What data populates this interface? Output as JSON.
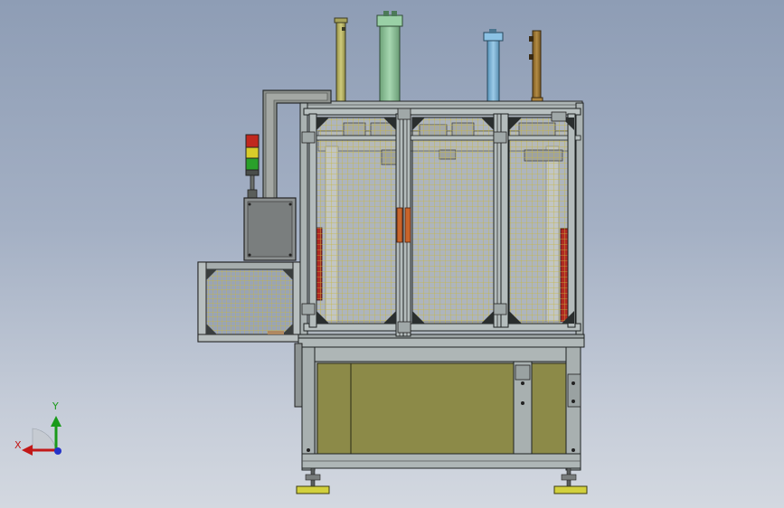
{
  "viewport": {
    "background_top": "#8e9db5",
    "background_bottom": "#d3d8e0"
  },
  "triad": {
    "x_label": "X",
    "y_label": "Y",
    "x_color": "#c21818",
    "y_color": "#1a9a1a",
    "z_color": "#2433c8"
  },
  "signal_tower": {
    "lights": [
      "red",
      "yellow",
      "green"
    ],
    "colors": [
      "#c0281e",
      "#d8cc2a",
      "#2aa02a"
    ]
  },
  "icons": {
    "axis_triad": "axis-triad-icon"
  },
  "colors": {
    "frame": "#b4bcbc",
    "frame_dark": "#2a2e2e",
    "mesh": "#c8b640",
    "panel": "#8c8a48",
    "cylinder_green": "#8ec49a",
    "cylinder_blue": "#78b4d8",
    "cylinder_olive": "#b8b462",
    "cylinder_brown": "#9a7430",
    "orange_block": "#c8642a",
    "red_block": "#b02a22",
    "foot_yellow": "#d2d03c"
  }
}
